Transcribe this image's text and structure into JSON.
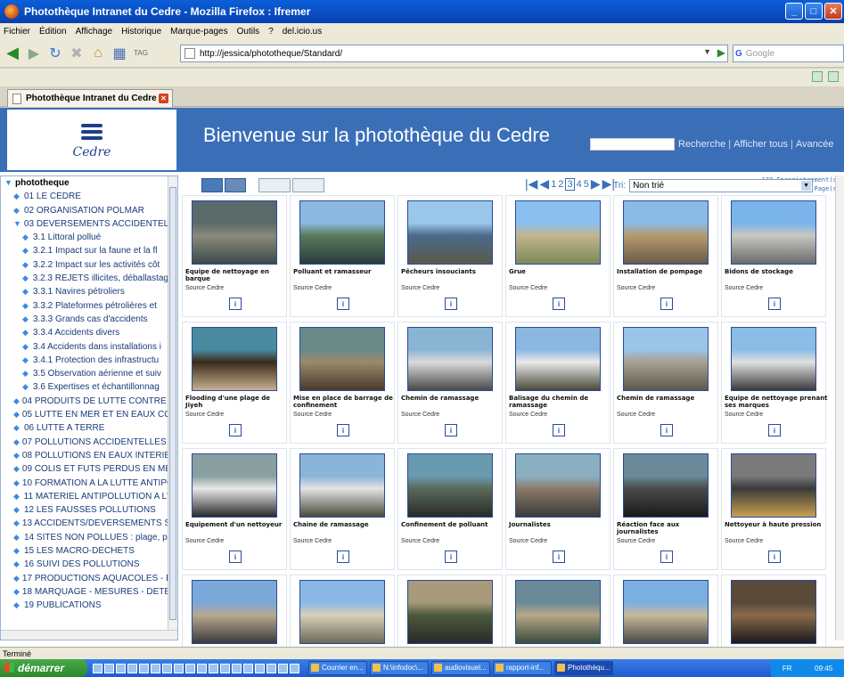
{
  "window": {
    "title": "Photothèque Intranet du Cedre - Mozilla Firefox : Ifremer"
  },
  "menu": [
    "Fichier",
    "Édition",
    "Affichage",
    "Historique",
    "Marque-pages",
    "Outils",
    "?",
    "del.icio.us"
  ],
  "url": "http://jessica/phototheque/Standard/",
  "search_engine": {
    "placeholder": "Google"
  },
  "tab": {
    "label": "Photothèque Intranet du Cedre"
  },
  "header": {
    "logo_text": "Cedre",
    "title": "Bienvenue sur la photothèque du Cedre",
    "links": [
      "Recherche",
      "Afficher tous",
      "Avancée"
    ]
  },
  "pager": {
    "pages": [
      "1",
      "2",
      "3",
      "4",
      "5"
    ],
    "current": "3"
  },
  "records": {
    "line1": "137  Enregistrement(s)",
    "line2": "5  Page(s)"
  },
  "sort": {
    "label": "Tri:",
    "value": "Non trié"
  },
  "tree": {
    "root": "phototheque",
    "items": [
      {
        "label": "01 LE CEDRE",
        "level": 1
      },
      {
        "label": "02 ORGANISATION POLMAR",
        "level": 1
      },
      {
        "label": "03 DEVERSEMENTS ACCIDENTELS",
        "level": 1
      },
      {
        "label": "3.1 Littoral pollué",
        "level": 2
      },
      {
        "label": "3.2.1 Impact sur la faune et la fl",
        "level": 2
      },
      {
        "label": "3.2.2 Impact sur les activités côt",
        "level": 2
      },
      {
        "label": "3.2.3 REJETS illicites, déballastag",
        "level": 2
      },
      {
        "label": "3.3.1 Navires pétroliers",
        "level": 2
      },
      {
        "label": "3.3.2 Plateformes pétrolières et",
        "level": 2
      },
      {
        "label": "3.3.3 Grands cas d'accidents",
        "level": 2
      },
      {
        "label": "3.3.4 Accidents divers",
        "level": 2
      },
      {
        "label": "3.4 Accidents dans installations i",
        "level": 2
      },
      {
        "label": "3.4.1 Protection des infrastructu",
        "level": 2
      },
      {
        "label": "3.5 Observation aérienne et suiv",
        "level": 2
      },
      {
        "label": "3.6 Expertises et échantillonnag",
        "level": 2
      },
      {
        "label": "04 PRODUITS DE LUTTE CONTRE L",
        "level": 1
      },
      {
        "label": "05 LUTTE EN MER ET EN EAUX CO",
        "level": 1
      },
      {
        "label": "06 LUTTE A TERRE",
        "level": 1
      },
      {
        "label": "07 POLLUTIONS ACCIDENTELLES I",
        "level": 1
      },
      {
        "label": "08 POLLUTIONS EN EAUX INTERIE",
        "level": 1
      },
      {
        "label": "09 COLIS ET FUTS PERDUS EN MEI",
        "level": 1
      },
      {
        "label": "10 FORMATION A LA LUTTE ANTIPC",
        "level": 1
      },
      {
        "label": "11 MATERIEL ANTIPOLLUTION A L'",
        "level": 1
      },
      {
        "label": "12 LES FAUSSES POLLUTIONS",
        "level": 1
      },
      {
        "label": "13 ACCIDENTS/DEVERSEMENTS SA",
        "level": 1
      },
      {
        "label": "14 SITES NON POLLUES : plage, p",
        "level": 1
      },
      {
        "label": "15 LES MACRO-DECHETS",
        "level": 1
      },
      {
        "label": "16 SUIVI DES POLLUTIONS",
        "level": 1
      },
      {
        "label": "17 PRODUCTIONS AQUACOLES - F",
        "level": 1
      },
      {
        "label": "18 MARQUAGE - MESURES - DETEC",
        "level": 1
      },
      {
        "label": "19 PUBLICATIONS",
        "level": 1
      }
    ]
  },
  "photos": [
    {
      "caption": "Equipe de nettoyage en barque",
      "source": "Source Cedre",
      "info": "i",
      "palette": [
        "#5a6a6a",
        "#8a8a7a",
        "#3a4a4a"
      ]
    },
    {
      "caption": "Polluant et ramasseur",
      "source": "Source Cedre",
      "info": "i",
      "palette": [
        "#8ab8e0",
        "#5a7a5a",
        "#2a3a3a"
      ]
    },
    {
      "caption": "Pêcheurs insouciants",
      "source": "Source Cedre",
      "info": "i",
      "palette": [
        "#9ac8ea",
        "#4a6a8a",
        "#5a5a4a"
      ]
    },
    {
      "caption": "Grue",
      "source": "Source Cedre",
      "info": "i",
      "palette": [
        "#8ac0f0",
        "#c4b48a",
        "#7a8a5a"
      ]
    },
    {
      "caption": "Installation de pompage",
      "source": "Source Cedre",
      "info": "i",
      "palette": [
        "#8abae6",
        "#b49a6a",
        "#6a5a4a"
      ]
    },
    {
      "caption": "Bidons de stockage",
      "source": "Source Cedre",
      "info": "i",
      "palette": [
        "#7ab4ea",
        "#c8c8c0",
        "#6a6a6a"
      ]
    },
    {
      "caption": "Flooding d'une plage de Jiyeh",
      "source": "Source Cedre",
      "info": "i",
      "palette": [
        "#4a8aa0",
        "#3a2a1a",
        "#c8b090"
      ]
    },
    {
      "caption": "Mise en place de barrage de confinement",
      "source": "Source Cedre",
      "info": "i",
      "palette": [
        "#6a8a8a",
        "#9a8a6a",
        "#4a3a2a"
      ]
    },
    {
      "caption": "Chemin de ramassage",
      "source": "Source Cedre",
      "info": "i",
      "palette": [
        "#8ab4d4",
        "#dadada",
        "#4a4a4a"
      ]
    },
    {
      "caption": "Balisage du chemin de ramassage",
      "source": "Source Cedre",
      "info": "i",
      "palette": [
        "#8ab8e0",
        "#eaeaea",
        "#4a4a3a"
      ]
    },
    {
      "caption": "Chemin de ramassage",
      "source": "Source Cedre",
      "info": "i",
      "palette": [
        "#9ac4e8",
        "#a8a090",
        "#5a5a4a"
      ]
    },
    {
      "caption": "Equipe de nettoyage prenant ses marques",
      "source": "Source Cedre",
      "info": "i",
      "palette": [
        "#8abce6",
        "#e0e0e0",
        "#3a3a3a"
      ]
    },
    {
      "caption": "Equipement d'un nettoyeur",
      "source": "Source Cedre",
      "info": "i",
      "palette": [
        "#8aa0a0",
        "#e8e8e8",
        "#2a2a2a"
      ]
    },
    {
      "caption": "Chaine de ramassage",
      "source": "Source Cedre",
      "info": "i",
      "palette": [
        "#8ab4d8",
        "#e4e4e4",
        "#4a4a3a"
      ]
    },
    {
      "caption": "Confinement de polluant",
      "source": "Source Cedre",
      "info": "i",
      "palette": [
        "#6a9ab0",
        "#5a6a5a",
        "#2a2a2a"
      ]
    },
    {
      "caption": "Journalistes",
      "source": "Source Cedre",
      "info": "i",
      "palette": [
        "#8ab0c0",
        "#8a7a6a",
        "#3a3a3a"
      ]
    },
    {
      "caption": "Réaction face aux journalistes",
      "source": "Source Cedre",
      "info": "i",
      "palette": [
        "#6a8a9a",
        "#4a4a4a",
        "#1a1a1a"
      ]
    },
    {
      "caption": "Nettoyeur à haute pression",
      "source": "Source Cedre",
      "info": "i",
      "palette": [
        "#7a7a7a",
        "#3a3a3a",
        "#c8a050"
      ]
    },
    {
      "caption": "",
      "source": "",
      "info": "",
      "palette": [
        "#7aa8d8",
        "#b8a890",
        "#3a3a3a"
      ]
    },
    {
      "caption": "",
      "source": "",
      "info": "",
      "palette": [
        "#8ab8e6",
        "#d8d0b8",
        "#6a6a5a"
      ]
    },
    {
      "caption": "",
      "source": "",
      "info": "",
      "palette": [
        "#a89a7a",
        "#4a5a3a",
        "#2a2a2a"
      ]
    },
    {
      "caption": "",
      "source": "",
      "info": "",
      "palette": [
        "#6a8a9a",
        "#b8a888",
        "#3a4a3a"
      ]
    },
    {
      "caption": "",
      "source": "",
      "info": "",
      "palette": [
        "#7ab0e0",
        "#c8b898",
        "#4a4a4a"
      ]
    },
    {
      "caption": "",
      "source": "",
      "info": "",
      "palette": [
        "#5a4a3a",
        "#8a6a4a",
        "#1a1a1a"
      ]
    }
  ],
  "status": "Terminé",
  "taskbar": {
    "start": "démarrer",
    "tasks": [
      "Courrier en...",
      "N:\\infodoc\\...",
      "audiovisuel...",
      "rapport-inf...",
      "Photothèqu..."
    ],
    "lang": "FR",
    "clock": "09:45"
  }
}
